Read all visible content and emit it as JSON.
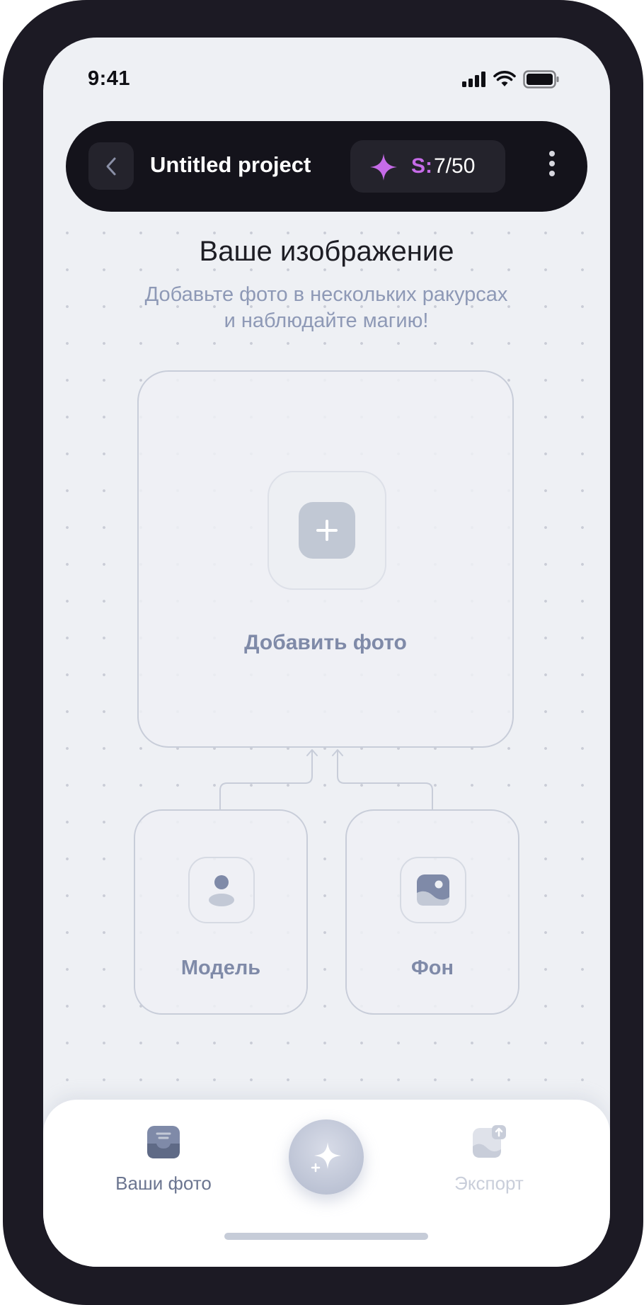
{
  "status_bar": {
    "time": "9:41"
  },
  "top_bar": {
    "project_title": "Untitled project",
    "credits_prefix": "S:",
    "credits_value": "7/50"
  },
  "main": {
    "heading": "Ваше изображение",
    "subheading_line1": "Добавьте фото в нескольких ракурсах",
    "subheading_line2": "и наблюдайте магию!",
    "add_photo_label": "Добавить фото",
    "model_label": "Модель",
    "background_label": "Фон"
  },
  "bottom_nav": {
    "photos_label": "Ваши фото",
    "export_label": "Экспорт"
  },
  "colors": {
    "accent": "#c66be8",
    "dark_bar": "#14131b",
    "muted_text": "#7f8aa8"
  },
  "icons": [
    "chevron-left-icon",
    "sparkle-icon",
    "more-vertical-icon",
    "plus-icon",
    "person-icon",
    "image-icon",
    "inbox-icon",
    "export-image-icon",
    "signal-icon",
    "wifi-icon",
    "battery-icon"
  ]
}
